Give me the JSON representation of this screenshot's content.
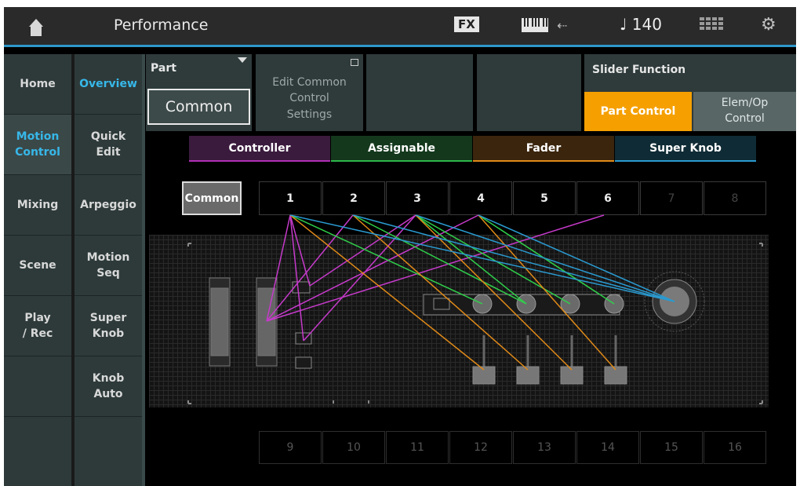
{
  "header": {
    "title": "Performance",
    "fx_label": "FX",
    "usb_symbol": "⇠",
    "tempo": "♩ 140"
  },
  "nav": {
    "col1": [
      {
        "label": "Home"
      },
      {
        "label": "Motion\nControl"
      },
      {
        "label": "Mixing"
      },
      {
        "label": "Scene"
      },
      {
        "label": "Play\n/ Rec"
      },
      {
        "label": ""
      },
      {
        "label": ""
      }
    ],
    "col2": [
      {
        "label": "Overview"
      },
      {
        "label": "Quick\nEdit"
      },
      {
        "label": "Arpeggio"
      },
      {
        "label": "Motion\nSeq"
      },
      {
        "label": "Super\nKnob"
      },
      {
        "label": "Knob\nAuto"
      },
      {
        "label": ""
      }
    ]
  },
  "part": {
    "label": "Part",
    "value": "Common"
  },
  "edit_common": {
    "label": "Edit Common\nControl\nSettings"
  },
  "slider_function": {
    "label": "Slider Function",
    "part_control": "Part Control",
    "elem_op": "Elem/Op\nControl"
  },
  "categories": {
    "controller": "Controller",
    "assignable": "Assignable",
    "fader": "Fader",
    "super_knob": "Super Knob"
  },
  "parts_top": [
    "Common",
    "1",
    "2",
    "3",
    "4",
    "5",
    "6",
    "7",
    "8"
  ],
  "parts_bottom": [
    "9",
    "10",
    "11",
    "12",
    "13",
    "14",
    "15",
    "16"
  ],
  "colors": {
    "accent": "#2f97c8",
    "selected": "#f5a000",
    "controller": "#c63acb",
    "assignable": "#2fd04a",
    "fader": "#e08a18",
    "super_knob": "#2a9ad0"
  },
  "icons": {
    "home": "home-icon",
    "keyboard": "keyboard-icon",
    "usb": "usb-icon",
    "grid": "grid-icon",
    "gear": "gear-icon"
  }
}
